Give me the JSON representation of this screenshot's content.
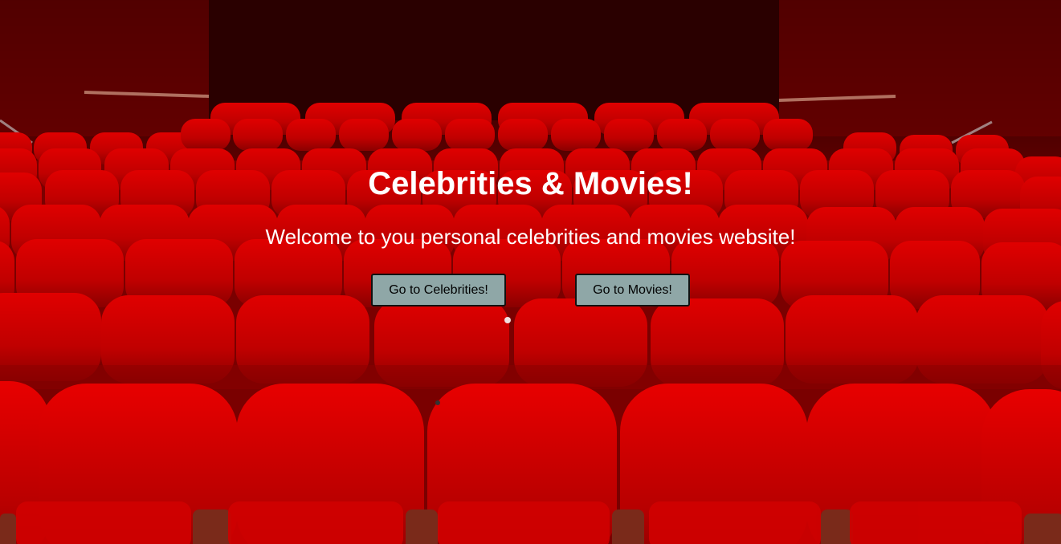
{
  "hero": {
    "title": "Celebrities & Movies!",
    "subtitle": "Welcome to you personal celebrities and movies website!"
  },
  "buttons": {
    "celebrities_label": "Go to Celebrities!",
    "movies_label": "Go to Movies!"
  },
  "background": {
    "description_icon": "theater-seats-image",
    "seat_color": "#c80000",
    "button_color": "#8fa7a7"
  }
}
